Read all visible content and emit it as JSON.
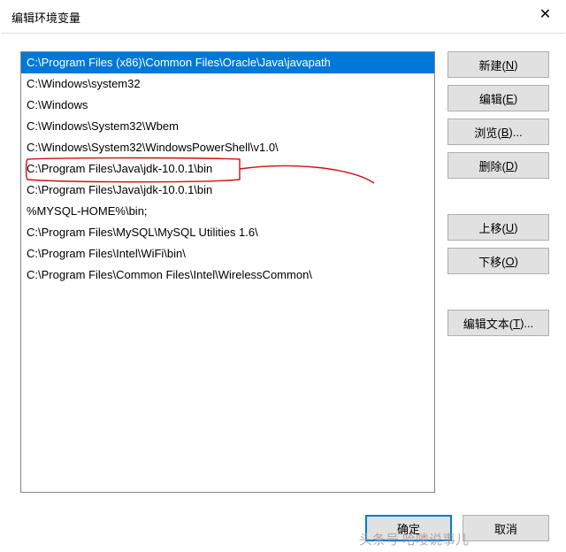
{
  "window": {
    "title": "编辑环境变量"
  },
  "list": {
    "items": [
      "C:\\Program Files (x86)\\Common Files\\Oracle\\Java\\javapath",
      "C:\\Windows\\system32",
      "C:\\Windows",
      "C:\\Windows\\System32\\Wbem",
      "C:\\Windows\\System32\\WindowsPowerShell\\v1.0\\",
      "C:\\Program Files\\Java\\jdk-10.0.1\\bin",
      "C:\\Program Files\\Java\\jdk-10.0.1\\bin",
      "%MYSQL-HOME%\\bin;",
      "C:\\Program Files\\MySQL\\MySQL Utilities 1.6\\",
      "C:\\Program Files\\Intel\\WiFi\\bin\\",
      "C:\\Program Files\\Common Files\\Intel\\WirelessCommon\\"
    ],
    "selected_index": 0,
    "annotated_index": 5
  },
  "buttons": {
    "new": {
      "label": "新建(",
      "key": "N",
      "suffix": ")"
    },
    "edit": {
      "label": "编辑(",
      "key": "E",
      "suffix": ")"
    },
    "browse": {
      "label": "浏览(",
      "key": "B",
      "suffix": ")..."
    },
    "delete": {
      "label": "删除(",
      "key": "D",
      "suffix": ")"
    },
    "up": {
      "label": "上移(",
      "key": "U",
      "suffix": ")"
    },
    "down": {
      "label": "下移(",
      "key": "O",
      "suffix": ")"
    },
    "edit_text": {
      "label": "编辑文本(",
      "key": "T",
      "suffix": ")..."
    }
  },
  "footer": {
    "ok": "确定",
    "cancel": "取消"
  },
  "watermark": "头条号  哈喽说事儿"
}
